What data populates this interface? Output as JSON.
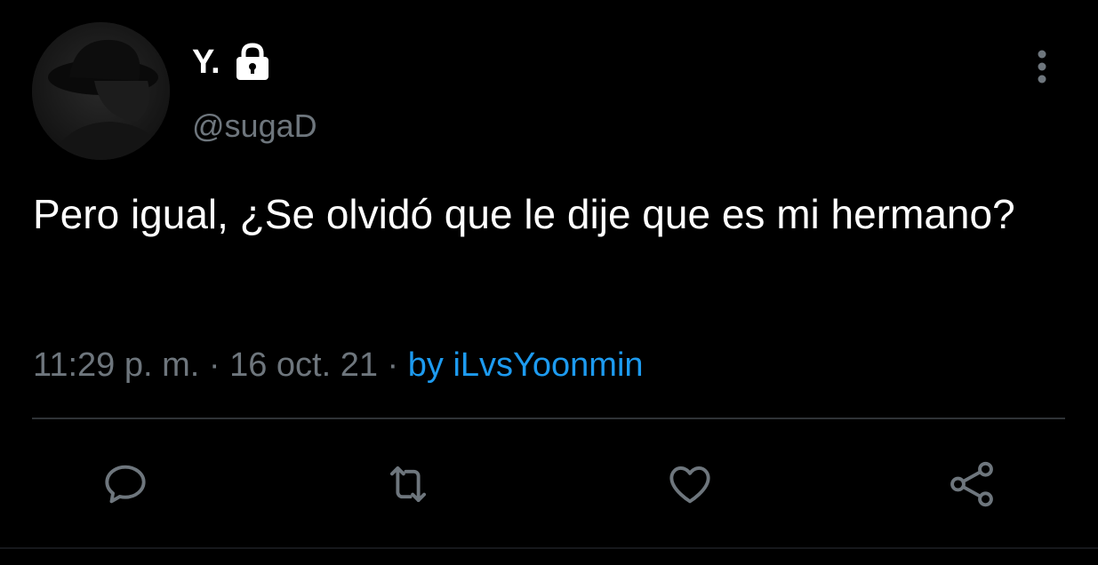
{
  "tweet": {
    "author": {
      "display_name": "Y.",
      "handle": "@sugaD",
      "avatar_icon": "avatar-photo",
      "protected_icon": "lock-icon"
    },
    "text": "Pero igual, ¿Se olvidó que le dije que es mi hermano?",
    "time": "11:29 p. m.",
    "sep1": " · ",
    "date": "16 oct. 21",
    "sep2": " · ",
    "via": "by iLvsYoonmin"
  },
  "actions": [
    {
      "icon": "reply-icon"
    },
    {
      "icon": "retweet-icon"
    },
    {
      "icon": "like-icon"
    },
    {
      "icon": "share-icon"
    }
  ],
  "menu": {
    "icon": "more-options-icon"
  },
  "colors": {
    "background": "#000000",
    "text_primary": "#ffffff",
    "text_secondary": "#6e767d",
    "accent": "#1d9bf0",
    "divider": "#2f3336"
  }
}
